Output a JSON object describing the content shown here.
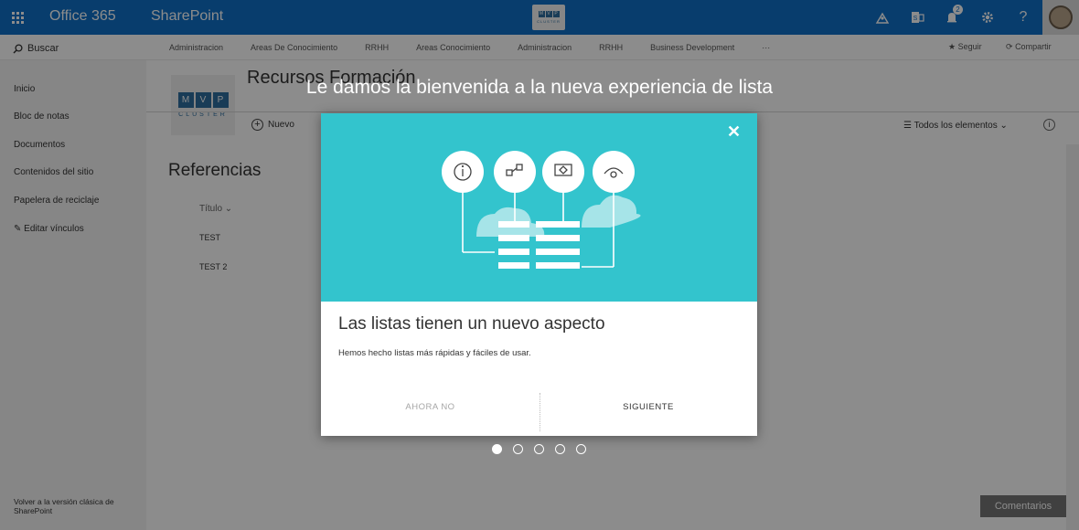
{
  "suitebar": {
    "brand": "Office 365",
    "app": "SharePoint",
    "notification_count": "2",
    "logo_letters": [
      "M",
      "V",
      "P"
    ],
    "logo_sub": "CLUSTER",
    "accent": "#0f6fc6"
  },
  "topnav": {
    "search": "Buscar",
    "items": [
      "Administracion",
      "Areas De Conocimiento",
      "RRHH",
      "Areas Conocimiento",
      "Administracion",
      "RRHH",
      "Business Development",
      "···"
    ],
    "follow": "Seguir",
    "share": "Compartir"
  },
  "leftnav": {
    "items": [
      "Inicio",
      "Bloc de notas",
      "Documentos",
      "Contenidos del sitio",
      "Papelera de reciclaje",
      "Editar vínculos"
    ],
    "classic": "Volver a la versión clásica de SharePoint"
  },
  "site": {
    "title": "Recursos Formación",
    "logo_letters": [
      "M",
      "V",
      "P"
    ],
    "logo_sub": "CLUSTER"
  },
  "command": {
    "new": "Nuevo",
    "view": "Todos los elementos"
  },
  "list": {
    "title": "Referencias",
    "column": "Título",
    "rows": [
      "TEST",
      "TEST 2"
    ]
  },
  "feedback": "Comentarios",
  "overlay": {
    "welcome": "Le damos la bienvenida a la nueva experiencia de lista",
    "dialog_title": "Las listas tienen un nuevo aspecto",
    "dialog_text": "Hemos hecho listas más rápidas y fáciles de usar.",
    "btn_not_now": "AHORA NO",
    "btn_next": "SIGUIENTE",
    "hero_color": "#33c4cd",
    "page_dots": 5,
    "active_dot": 1
  }
}
